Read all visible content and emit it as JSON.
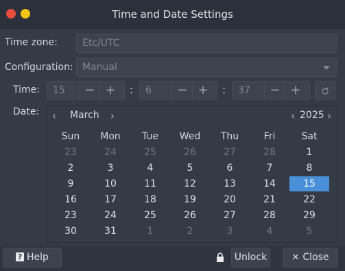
{
  "window": {
    "title": "Time and Date Settings",
    "colors": {
      "close": "#e74c3c",
      "minimize": "#f1c40f",
      "selected": "#4a90d9"
    }
  },
  "timezone": {
    "label": "Time zone:",
    "value": "Etc/UTC"
  },
  "configuration": {
    "label": "Configuration:",
    "value": "Manual"
  },
  "time": {
    "label": "Time:",
    "hour": "15",
    "minute": "6",
    "second": "37",
    "minus": "−",
    "plus": "+",
    "separator": ":",
    "revert_icon": "refresh-icon"
  },
  "date": {
    "label": "Date:",
    "month": "March",
    "year": "2025",
    "prev": "‹",
    "next": "›",
    "weekdays": [
      "Sun",
      "Mon",
      "Tue",
      "Wed",
      "Thu",
      "Fri",
      "Sat"
    ],
    "weeks": [
      [
        "23",
        "24",
        "25",
        "26",
        "27",
        "28",
        "1"
      ],
      [
        "2",
        "3",
        "4",
        "5",
        "6",
        "7",
        "8"
      ],
      [
        "9",
        "10",
        "11",
        "12",
        "13",
        "14",
        "15"
      ],
      [
        "16",
        "17",
        "18",
        "19",
        "20",
        "21",
        "22"
      ],
      [
        "23",
        "24",
        "25",
        "26",
        "27",
        "28",
        "29"
      ],
      [
        "30",
        "31",
        "1",
        "2",
        "3",
        "4",
        "5"
      ]
    ],
    "selected": "15"
  },
  "buttons": {
    "help": "Help",
    "help_icon": "?",
    "unlock": "Unlock",
    "close": "Close",
    "close_icon": "✕"
  }
}
